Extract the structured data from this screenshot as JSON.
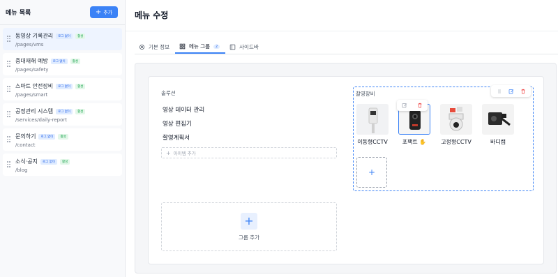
{
  "sidebar": {
    "title": "메뉴 목록",
    "add_label": "추가",
    "items": [
      {
        "label": "동영상 기록관리",
        "path": "/pages/vms",
        "tags": [
          "로그 없이",
          "활성"
        ]
      },
      {
        "label": "중대재해 예방",
        "path": "/pages/safety",
        "tags": [
          "로그 없이",
          "활성"
        ]
      },
      {
        "label": "스마트 안전장비",
        "path": "/pages/smart",
        "tags": [
          "로그 없이",
          "활성"
        ]
      },
      {
        "label": "공정관리 시스템",
        "path": "/services/daily-report",
        "tags": [
          "로그 없이",
          "활성"
        ]
      },
      {
        "label": "문의하기",
        "path": "/contact",
        "tags": [
          "로그 없이",
          "활성"
        ]
      },
      {
        "label": "소식·공지",
        "path": "/blog",
        "tags": [
          "로그 없이",
          "활성"
        ]
      }
    ]
  },
  "main": {
    "title": "메뉴 수정",
    "tabs": [
      {
        "label": "기본 정보",
        "icon": "gear-icon"
      },
      {
        "label": "메뉴 그룹",
        "icon": "grid-icon",
        "badge": "2"
      },
      {
        "label": "사이드바",
        "icon": "sidebar-icon"
      }
    ],
    "groups": {
      "left": {
        "title": "솔루션",
        "items": [
          "영상 데이터 관리",
          "영상 편집기",
          "촬영계획서"
        ],
        "add_item_label": "아이템 추가"
      },
      "right": {
        "title": "촬영장비",
        "devices": [
          {
            "label": "이동형CCTV",
            "icon": "mobile-cctv"
          },
          {
            "label": "포팩트",
            "icon": "bodycam"
          },
          {
            "label": "고정형CCTV",
            "icon": "ptz-camera"
          },
          {
            "label": "바디캠",
            "icon": "bodycam-mount"
          }
        ]
      }
    },
    "add_group_label": "그룹 추가"
  },
  "colors": {
    "accent": "#3b82f6",
    "danger": "#ef4444"
  }
}
